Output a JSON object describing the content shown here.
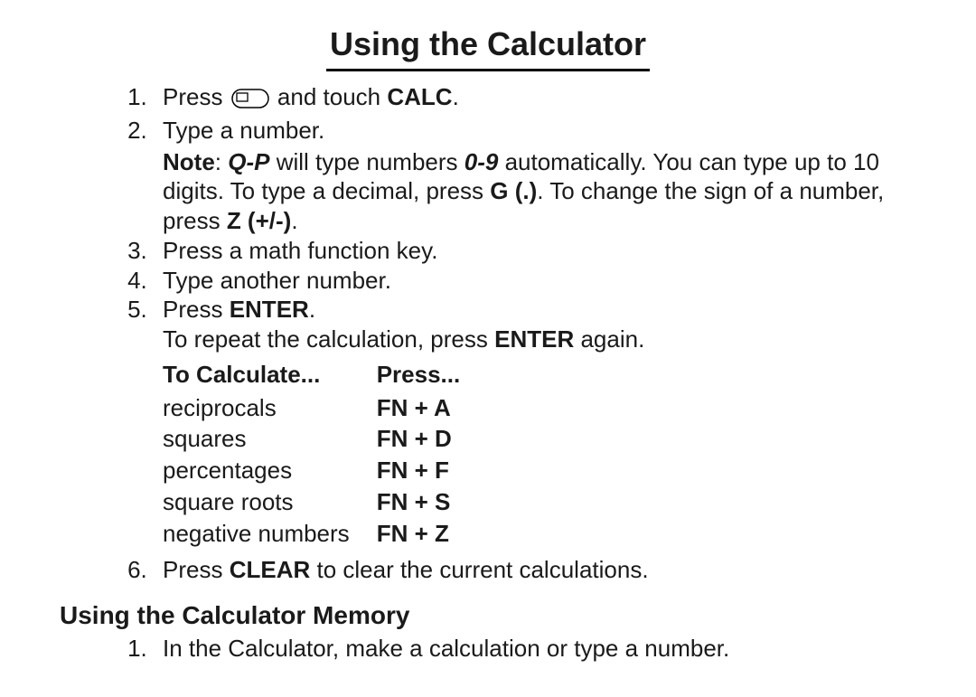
{
  "title": "Using the Calculator",
  "steps": {
    "s1_a": "Press ",
    "s1_b": " and touch ",
    "s1_calc": "CALC",
    "s1_c": ".",
    "s2": "Type a number.",
    "note_label": "Note",
    "note_a": ": ",
    "note_qp": "Q-P",
    "note_b": " will type numbers ",
    "note_09": "0-9",
    "note_c": " automatically. You can type up to 10 digits. To type a decimal, press ",
    "note_g": "G (.)",
    "note_d": ". To change the sign of a number, press ",
    "note_z": "Z (+/-)",
    "note_e": ".",
    "s3": "Press a math function key.",
    "s4": "Type another number.",
    "s5_a": "Press ",
    "s5_enter": "ENTER",
    "s5_b": ".",
    "s5_rep_a": "To repeat the calculation, press ",
    "s5_rep_enter": "ENTER",
    "s5_rep_b": " again.",
    "s6_a": "Press ",
    "s6_clear": "CLEAR",
    "s6_b": " to clear the current calculations."
  },
  "table": {
    "h1": "To Calculate...",
    "h2": "Press...",
    "rows": [
      {
        "label": "reciprocals",
        "key": "FN + A"
      },
      {
        "label": "squares",
        "key": "FN + D"
      },
      {
        "label": "percentages",
        "key": "FN + F"
      },
      {
        "label": "square roots",
        "key": "FN + S"
      },
      {
        "label": "negative numbers",
        "key": "FN + Z"
      }
    ]
  },
  "memory": {
    "heading": "Using the Calculator Memory",
    "m1": "In the Calculator, make a calculation or type a number."
  }
}
